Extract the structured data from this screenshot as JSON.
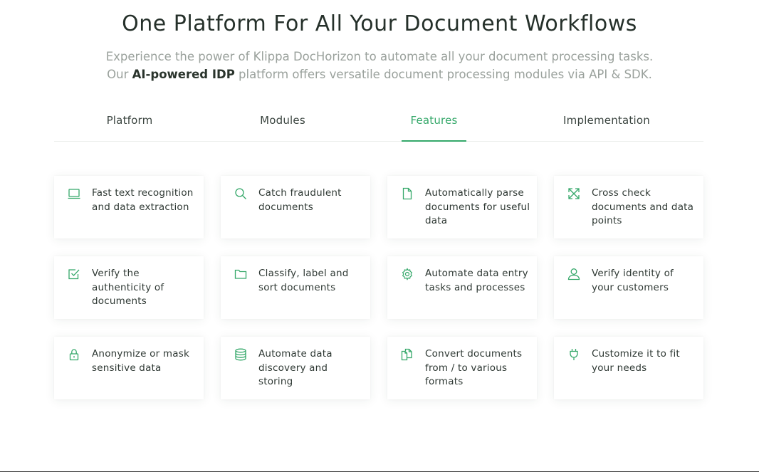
{
  "header": {
    "title": "One Platform For All Your Document Workflows",
    "subtitle_line1": "Experience the power of Klippa DocHorizon to automate all your document processing tasks.",
    "subtitle_line2_prefix": "Our ",
    "subtitle_line2_bold": "AI-powered IDP",
    "subtitle_line2_suffix": " platform offers versatile document processing modules via API & SDK."
  },
  "tabs": [
    {
      "label": "Platform",
      "active": false
    },
    {
      "label": "Modules",
      "active": false
    },
    {
      "label": "Features",
      "active": true
    },
    {
      "label": "Implementation",
      "active": false
    }
  ],
  "features": [
    {
      "label": "Fast text recognition and data extraction",
      "icon": "laptop-icon"
    },
    {
      "label": "Catch fraudulent documents",
      "icon": "search-icon"
    },
    {
      "label": "Automatically parse documents for useful data",
      "icon": "file-icon"
    },
    {
      "label": "Cross check documents and data points",
      "icon": "expand-arrows-icon"
    },
    {
      "label": "Verify the authenticity of documents",
      "icon": "checkbox-icon"
    },
    {
      "label": "Classify, label and sort documents",
      "icon": "folder-icon"
    },
    {
      "label": "Automate data entry tasks and processes",
      "icon": "gear-icon"
    },
    {
      "label": "Verify identity of your customers",
      "icon": "user-icon"
    },
    {
      "label": "Anonymize or mask sensitive data",
      "icon": "lock-icon"
    },
    {
      "label": "Automate data discovery and storing",
      "icon": "database-icon"
    },
    {
      "label": "Convert documents from / to various formats",
      "icon": "files-icon"
    },
    {
      "label": "Customize it to fit your needs",
      "icon": "plug-icon"
    }
  ],
  "colors": {
    "accent": "#35a86a",
    "text": "#2e3833",
    "muted": "#9aa19c"
  }
}
